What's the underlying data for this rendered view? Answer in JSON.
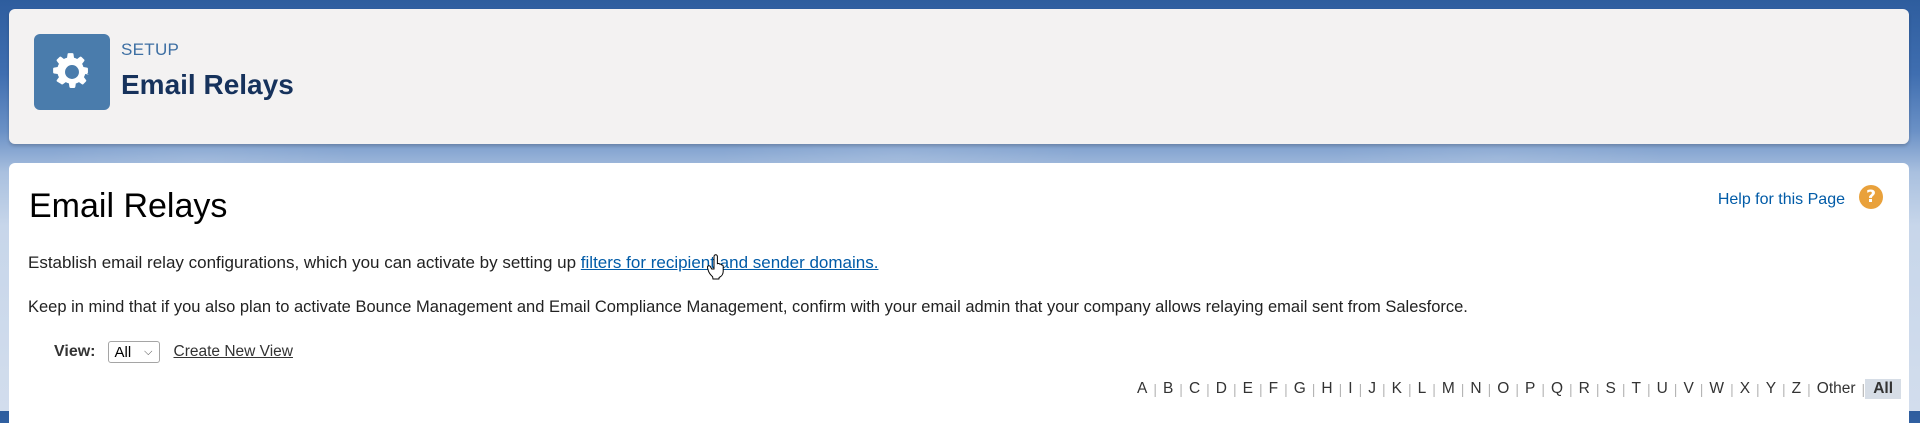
{
  "header": {
    "eyebrow": "SETUP",
    "title": "Email Relays",
    "icon": "gear-icon",
    "icon_bg": "#4a7cac"
  },
  "main": {
    "title": "Email Relays",
    "help_link": "Help for this Page",
    "help_icon": "?",
    "description_prefix": "Establish email relay configurations, which you can activate by setting up ",
    "description_link": "filters for recipient and sender domains.",
    "note": "Keep in mind that if you also plan to activate Bounce Management and Email Compliance Management, confirm with your email admin that your company allows relaying email sent from Salesforce."
  },
  "view": {
    "label": "View:",
    "selected": "All",
    "create_link": "Create New View"
  },
  "alphabet": {
    "letters": [
      "A",
      "B",
      "C",
      "D",
      "E",
      "F",
      "G",
      "H",
      "I",
      "J",
      "K",
      "L",
      "M",
      "N",
      "O",
      "P",
      "Q",
      "R",
      "S",
      "T",
      "U",
      "V",
      "W",
      "X",
      "Y",
      "Z",
      "Other"
    ],
    "active": "All"
  },
  "colors": {
    "link": "#015ba7",
    "help_icon": "#e9a13b",
    "header_title": "#16325c"
  }
}
